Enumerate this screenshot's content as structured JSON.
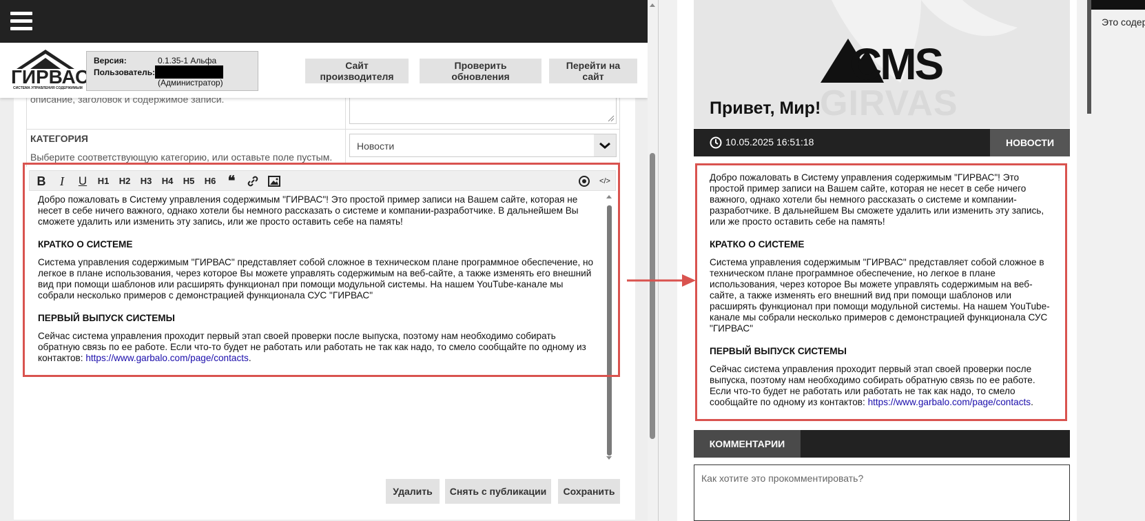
{
  "header": {
    "logo_text": "ГИРВАС",
    "logo_subtitle": "СИСТЕМА УПРАВЛЕНИЯ СОДЕРЖИМЫМ",
    "version_label": "Версия:",
    "version_value": "0.1.35-1 Альфа",
    "user_label": "Пользователь:",
    "user_role": "(Администратор)",
    "buttons": [
      "Сайт производителя",
      "Проверить обновления",
      "Перейти на сайт"
    ]
  },
  "form": {
    "top_help": "описание, заголовок и содержимое записи.",
    "category_label": "КАТЕГОРИЯ",
    "category_help": "Выберите соответствующую категорию, или оставьте поле пустым.",
    "category_value": "Новости"
  },
  "toolbar": {
    "bold": "B",
    "italic": "I",
    "underline": "U",
    "h1": "H1",
    "h2": "H2",
    "h3": "H3",
    "h4": "H4",
    "h5": "H5",
    "h6": "H6",
    "quote": "❝",
    "link": "🔗",
    "image": "🖼",
    "preview": "◉",
    "code": "</>"
  },
  "content": {
    "intro": "Добро пожаловать в Систему управления содержимым \"ГИРВАС\"! Это простой пример записи на Вашем сайте, которая не несет в себе ничего важного, однако хотели бы немного рассказать о системе и компании-разработчике. В дальнейшем Вы сможете удалить или изменить эту запись, или же просто оставить себе на память!",
    "h_about": "КРАТКО О СИСТЕМЕ",
    "about": "Система управления содержимым \"ГИРВАС\" представляет собой сложное в техническом плане программное обеспечение, но легкое в плане использования, через которое Вы можете управлять содержимым на веб-сайте, а также изменять его внешний вид при помощи шаблонов или расширять функционал при помощи модульной системы. На нашем YouTube-канале мы собрали несколько примеров с демонстрацией функционала СУС \"ГИРВАС\"",
    "h_release": "ПЕРВЫЙ ВЫПУСК СИСТЕМЫ",
    "release": "Сейчас система управления проходит первый этап своей проверки после выпуска, поэтому нам необходимо собирать обратную связь по ее работе. Если что-то будет не работать или работать не так как надо, то смело сообщайте по одному из контактов: ",
    "link": "https://www.garbalo.com/page/contacts",
    "dot": "."
  },
  "actions": [
    "Удалить",
    "Снять с публикации",
    "Сохранить"
  ],
  "preview": {
    "cms_text": "CMS",
    "watermark": "GIRVAS",
    "title": "Привет, Мир!",
    "date": "10.05.2025 16:51:18",
    "category": "НОВОСТИ",
    "comments_tab": "КОММЕНТАРИИ",
    "comment_placeholder": "Как хотите это прокомментировать?"
  },
  "sidebar_right": {
    "text": "Это содер"
  },
  "colors": {
    "highlight": "#d9534f",
    "dark": "#222222",
    "link": "#1a0dab"
  }
}
